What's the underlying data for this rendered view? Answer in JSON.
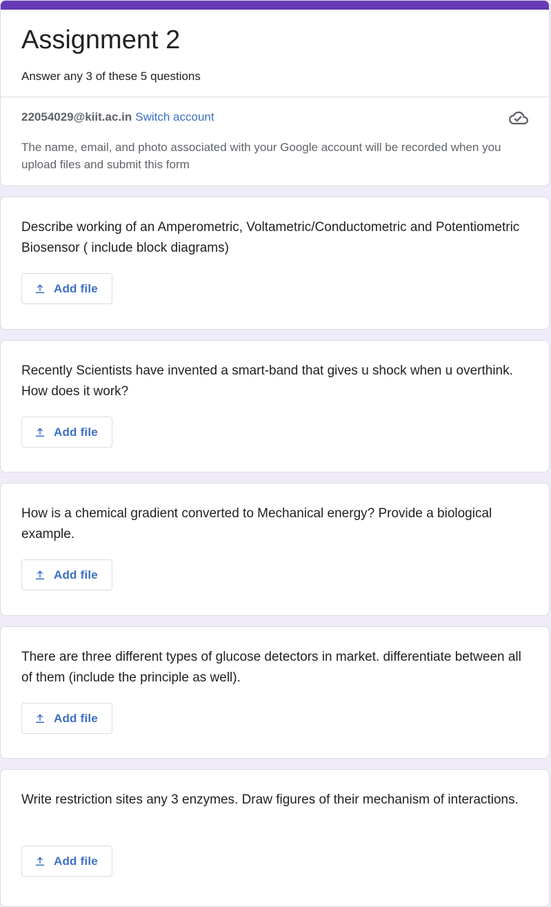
{
  "form": {
    "title": "Assignment 2",
    "description": "Answer any 3 of these 5 questions",
    "account_email": "22054029@kiit.ac.in",
    "switch_account": "Switch account",
    "notice": "The name, email, and photo associated with your Google account will be recorded when you upload files and submit this form"
  },
  "colors": {
    "theme": "#673ab7",
    "background": "#f0ebf8",
    "link": "#3b6fc4"
  },
  "questions": [
    {
      "text": "Describe working of an Amperometric, Voltametric/Conductometric and Potentiometric Biosensor ( include block diagrams)",
      "button": "Add file"
    },
    {
      "text": "Recently Scientists have invented a smart-band that gives u shock when u overthink. How does it work?",
      "button": "Add file"
    },
    {
      "text": "How is a chemical gradient converted to Mechanical energy? Provide a biological example.",
      "button": "Add file"
    },
    {
      "text": "There are three different types of glucose detectors in market. differentiate between all of them (include the principle as well).",
      "button": "Add file"
    },
    {
      "text": "Write restriction sites any 3 enzymes. Draw figures of their mechanism of interactions.",
      "button": "Add file"
    }
  ],
  "icons": {
    "cloud": "cloud-done-icon",
    "upload": "upload-icon"
  }
}
